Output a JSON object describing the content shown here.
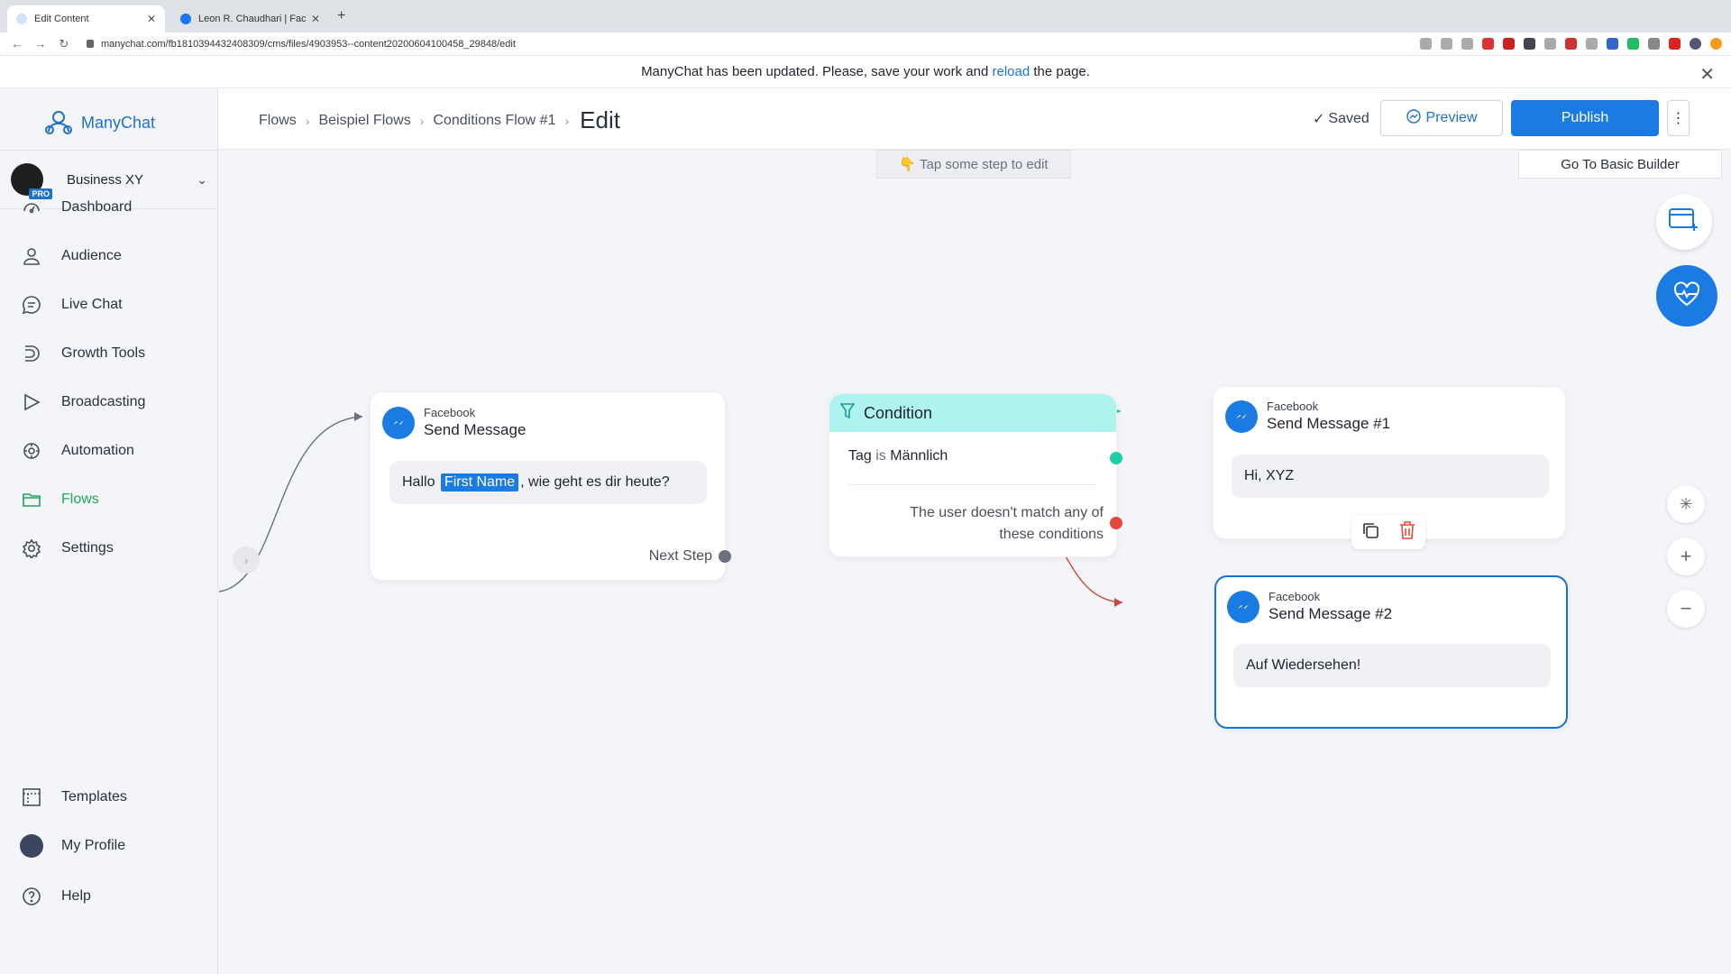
{
  "browser": {
    "tabs": [
      {
        "label": "Edit Content",
        "active": true
      },
      {
        "label": "Leon R. Chaudhari | Facebook",
        "active": false
      }
    ],
    "url": "manychat.com/fb181039443240830​9/cms/files/4903953--content20200604100458_29848/edit"
  },
  "notice": {
    "text_before": "ManyChat has been updated. Please, save your work and",
    "link": "reload",
    "text_after": "the page."
  },
  "sidebar": {
    "brand": "ManyChat",
    "account": {
      "name": "Business XY",
      "badge": "PRO"
    },
    "items": [
      {
        "label": "Dashboard",
        "icon": "dashboard-icon"
      },
      {
        "label": "Audience",
        "icon": "user-icon"
      },
      {
        "label": "Live Chat",
        "icon": "chat-icon"
      },
      {
        "label": "Growth Tools",
        "icon": "growth-icon"
      },
      {
        "label": "Broadcasting",
        "icon": "send-icon"
      },
      {
        "label": "Automation",
        "icon": "automation-icon"
      },
      {
        "label": "Flows",
        "icon": "folder-icon",
        "active": true
      },
      {
        "label": "Settings",
        "icon": "gear-icon"
      }
    ],
    "bottom": [
      {
        "label": "Templates",
        "icon": "templates-icon"
      },
      {
        "label": "My Profile",
        "icon": "avatar"
      },
      {
        "label": "Help",
        "icon": "help-icon"
      }
    ]
  },
  "header": {
    "breadcrumbs": [
      "Flows",
      "Beispiel Flows",
      "Conditions Flow #1"
    ],
    "current": "Edit",
    "saved": "Saved",
    "preview": "Preview",
    "publish": "Publish"
  },
  "canvas": {
    "hint": "👇 Tap some step to edit",
    "basic_builder": "Go To Basic Builder",
    "send_message": {
      "platform": "Facebook",
      "title": "Send Message",
      "text_before": "Hallo",
      "variable": "First Name",
      "text_after": ", wie geht es dir heute?",
      "next_step": "Next Step"
    },
    "condition": {
      "title": "Condition",
      "rule_prefix": "Tag",
      "rule_op": "is",
      "rule_value": "Männlich",
      "else_text": "The user doesn't match any of these conditions"
    },
    "message1": {
      "platform": "Facebook",
      "title": "Send Message #1",
      "text": "Hi, XYZ"
    },
    "message2": {
      "platform": "Facebook",
      "title": "Send Message #2",
      "text": "Auf Wiedersehen!"
    }
  },
  "colors": {
    "accent": "#1a7be3",
    "flows_active": "#21a65c",
    "condition_header": "#aef3ef",
    "port_true": "#1ccfa8",
    "port_false": "#e5483c"
  }
}
